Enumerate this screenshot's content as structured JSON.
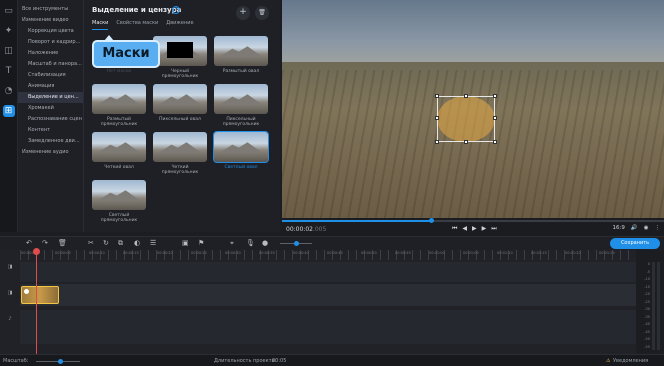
{
  "tree": {
    "items": [
      {
        "label": "Все инструменты",
        "root": true
      },
      {
        "label": "Изменение видео",
        "root": true
      },
      {
        "label": "Коррекция цвета"
      },
      {
        "label": "Поворот и кадриро..."
      },
      {
        "label": "Наложение"
      },
      {
        "label": "Масштаб и панора..."
      },
      {
        "label": "Стабилизация"
      },
      {
        "label": "Анимация"
      },
      {
        "label": "Выделение и цен...",
        "selected": true
      },
      {
        "label": "Хромакей"
      },
      {
        "label": "Распознавание сцен"
      },
      {
        "label": "Контент"
      },
      {
        "label": "Замедленное движ..."
      },
      {
        "label": "Изменение аудио",
        "root": true
      }
    ]
  },
  "panel": {
    "title": "Выделение и цензура",
    "help": "?",
    "add": "+",
    "delete": "🗑",
    "tabs": [
      "Маски",
      "Свойства маски",
      "Движение"
    ],
    "tooltip": "Маски"
  },
  "masks": [
    {
      "label": "Нет маски",
      "hidden": true
    },
    {
      "label": "Черный прямоугольник"
    },
    {
      "label": "Размытый овал"
    },
    {
      "label": "Размытый прямоугольник"
    },
    {
      "label": "Пиксельный овал"
    },
    {
      "label": "Пиксельный прямоугольник"
    },
    {
      "label": "Четкий овал"
    },
    {
      "label": "Четкий прямоугольник"
    },
    {
      "label": "Светлый овал",
      "selected": true
    },
    {
      "label": "Светлый прямоугольник"
    }
  ],
  "player": {
    "time": "00:00:02",
    "time_frac": ".005",
    "progress_pct": 39,
    "aspect": "16:9",
    "ctrl_prev": "⏮",
    "ctrl_back": "◀",
    "ctrl_play": "▶",
    "ctrl_fwd": "▶",
    "ctrl_next": "⏭",
    "vol": "🔊",
    "more": "⋮"
  },
  "toolbar": {
    "export": "Сохранить"
  },
  "ruler_labels": [
    "00:00:00",
    "00:00:05",
    "00:00:10",
    "00:00:15",
    "00:00:20",
    "00:00:25",
    "00:00:30",
    "00:00:35",
    "00:00:40",
    "00:00:45",
    "00:00:50",
    "00:00:55",
    "00:01:00",
    "00:01:05",
    "00:01:10",
    "00:01:15",
    "00:01:20",
    "00:01:25"
  ],
  "meter": [
    "0",
    "-5",
    "-10",
    "-15",
    "-20",
    "-25",
    "-30",
    "-35",
    "-40",
    "-45",
    "-50",
    "-55"
  ],
  "status": {
    "scale_label": "Масштаб:",
    "duration_label": "Длительность проекта:",
    "duration": "00:05",
    "notify": "Уведомления"
  }
}
